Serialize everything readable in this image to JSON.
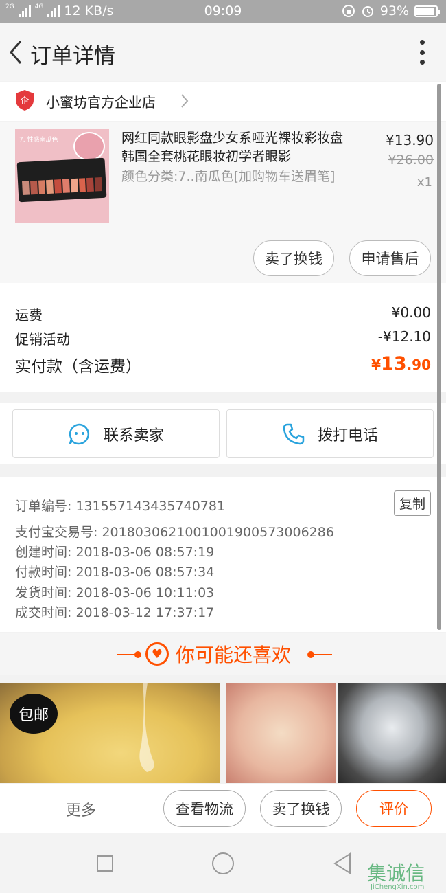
{
  "status": {
    "network_speed": "12 KB/s",
    "time": "09:09",
    "battery": "93%",
    "battery_level": 0.93,
    "net_label_1": "2G",
    "net_label_2": "4G"
  },
  "header": {
    "title": "订单详情"
  },
  "shop": {
    "name": "小蜜坊官方企业店",
    "logo_char": "企"
  },
  "product": {
    "title": "网红同款眼影盘少女系哑光裸妆彩妆盘韩国全套桃花眼妆初学者眼影",
    "spec": "颜色分类:7..南瓜色[加购物车送眉笔]",
    "price": "¥13.90",
    "original_price": "¥26.00",
    "quantity": "x1",
    "image_tag": "7. 性感南瓜色",
    "sell_button": "卖了换钱",
    "aftersale_button": "申请售后"
  },
  "totals": {
    "shipping_label": "运费",
    "shipping_value": "¥0.00",
    "promo_label": "促销活动",
    "promo_value": "-¥12.10",
    "paid_label": "实付款（含运费）",
    "paid_currency": "¥",
    "paid_int": "13",
    "paid_dec": ".90"
  },
  "contact": {
    "seller": "联系卖家",
    "phone": "拨打电话"
  },
  "order": {
    "number_label": "订单编号:",
    "number": "131557143435740781",
    "copy_button": "复制",
    "alipay_label": "支付宝交易号:",
    "alipay": "2018030621001001900573006286",
    "created_label": "创建时间:",
    "created": "2018-03-06 08:57:19",
    "paid_label": "付款时间:",
    "paid": "2018-03-06 08:57:34",
    "shipped_label": "发货时间:",
    "shipped": "2018-03-06 10:11:03",
    "closed_label": "成交时间:",
    "closed": "2018-03-12 17:37:17"
  },
  "recommend": {
    "title": "你可能还喜欢",
    "free_shipping": "包邮"
  },
  "actions": {
    "more": "更多",
    "logistics": "查看物流",
    "sell": "卖了换钱",
    "review": "评价"
  },
  "watermark": {
    "text": "集诚信",
    "sub": "JiChengXin.com"
  },
  "colors": {
    "accent": "#ff5000",
    "contact_icon": "#29a3dd"
  }
}
